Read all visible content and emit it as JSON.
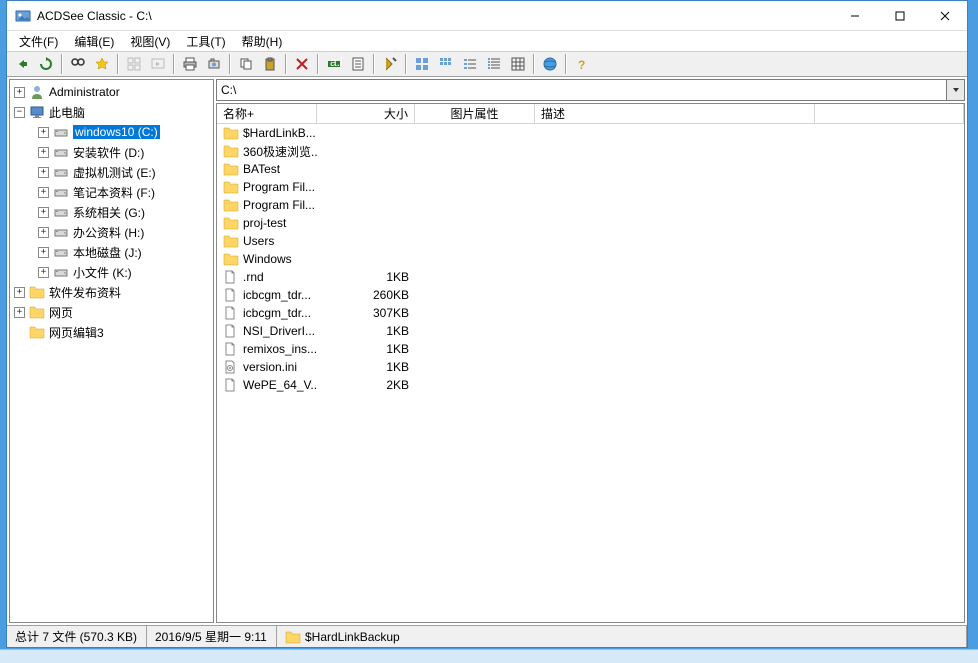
{
  "window": {
    "title": "ACDSee Classic - C:\\"
  },
  "menu": {
    "file": "文件(F)",
    "edit": "编辑(E)",
    "view": "视图(V)",
    "tools": "工具(T)",
    "help": "帮助(H)"
  },
  "path": {
    "value": "C:\\"
  },
  "tree": {
    "admin": "Administrator",
    "thispc": "此电脑",
    "drives": [
      {
        "label": "windows10 (C:)",
        "selected": true
      },
      {
        "label": "安装软件 (D:)"
      },
      {
        "label": "虚拟机测试 (E:)"
      },
      {
        "label": "笔记本资料 (F:)"
      },
      {
        "label": "系统相关 (G:)"
      },
      {
        "label": "办公资料 (H:)"
      },
      {
        "label": "本地磁盘 (J:)"
      },
      {
        "label": "小文件 (K:)"
      }
    ],
    "folders": [
      {
        "label": "软件发布资料",
        "exp": true
      },
      {
        "label": "网页",
        "exp": true
      },
      {
        "label": "网页编辑3",
        "exp": false
      }
    ]
  },
  "columns": {
    "name": "名称+",
    "size": "大小",
    "imgattr": "图片属性",
    "desc": "描述"
  },
  "files": [
    {
      "name": "$HardLinkB...",
      "type": "folder"
    },
    {
      "name": "360极速浏览...",
      "type": "folder"
    },
    {
      "name": "BATest",
      "type": "folder"
    },
    {
      "name": "Program Fil...",
      "type": "folder"
    },
    {
      "name": "Program Fil...",
      "type": "folder"
    },
    {
      "name": "proj-test",
      "type": "folder"
    },
    {
      "name": "Users",
      "type": "folder"
    },
    {
      "name": "Windows",
      "type": "folder"
    },
    {
      "name": ".rnd",
      "type": "file",
      "size": "1KB"
    },
    {
      "name": "icbcgm_tdr...",
      "type": "file",
      "size": "260KB"
    },
    {
      "name": "icbcgm_tdr...",
      "type": "file",
      "size": "307KB"
    },
    {
      "name": "NSI_DriverI...",
      "type": "file",
      "size": "1KB"
    },
    {
      "name": "remixos_ins...",
      "type": "file",
      "size": "1KB"
    },
    {
      "name": "version.ini",
      "type": "ini",
      "size": "1KB"
    },
    {
      "name": "WePE_64_V...",
      "type": "file",
      "size": "2KB"
    }
  ],
  "status": {
    "total": "总计 7 文件 (570.3 KB)",
    "date": "2016/9/5 星期一 9:11",
    "selected": "$HardLinkBackup"
  }
}
